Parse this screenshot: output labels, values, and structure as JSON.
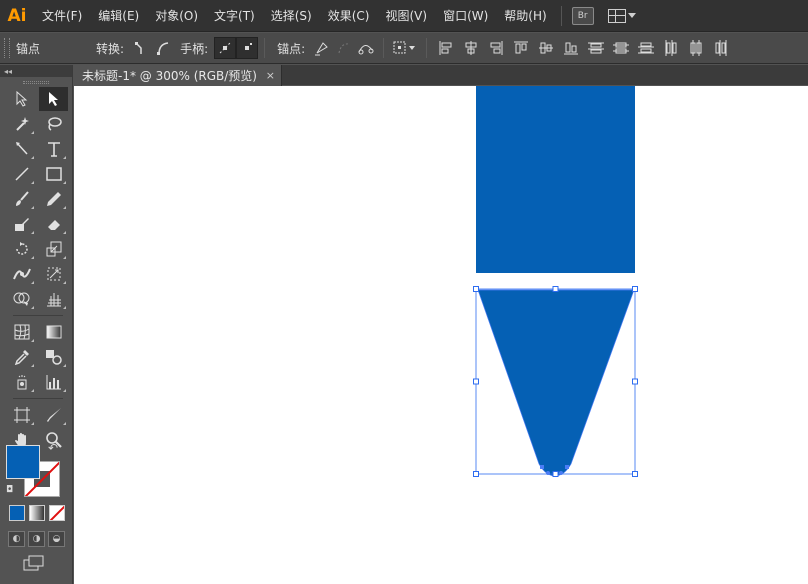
{
  "app": {
    "logo": "Ai"
  },
  "menu": [
    "文件(F)",
    "编辑(E)",
    "对象(O)",
    "文字(T)",
    "选择(S)",
    "效果(C)",
    "视图(V)",
    "窗口(W)",
    "帮助(H)"
  ],
  "menubar_right": {
    "bridge_label": "Br"
  },
  "control": {
    "object_type": "锚点",
    "convert_label": "转换:",
    "handles_label": "手柄:",
    "anchors_label": "锚点:"
  },
  "toolbox": {
    "collapse_glyph": "◂◂"
  },
  "document": {
    "tab_title": "未标题-1* @ 300% (RGB/预览)",
    "close_glyph": "×"
  },
  "colors": {
    "fill": "#0560b4",
    "shape_blue": "#0560b4",
    "selection": "#2e6cf0",
    "app_accent": "#ff9a00"
  }
}
